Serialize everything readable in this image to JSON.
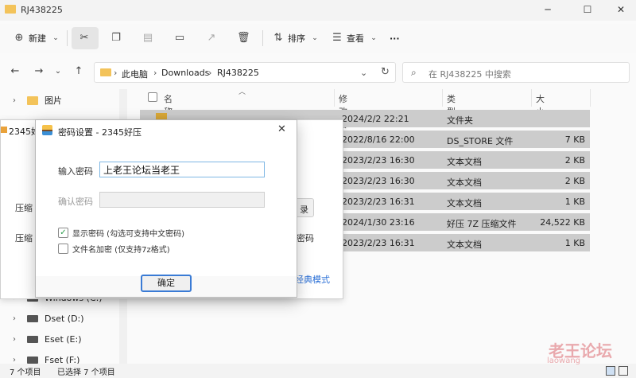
{
  "window": {
    "title": "RJ438225"
  },
  "toolbar": {
    "new_label": "新建",
    "sort_label": "排序",
    "view_label": "查看",
    "more_label": "···"
  },
  "address": {
    "crumbs": [
      "此电脑",
      "Downloads",
      "RJ438225"
    ],
    "search_placeholder": "在 RJ438225 中搜索"
  },
  "sidebar": {
    "items": [
      {
        "label": "图片",
        "icon": "pictures-folder-icon"
      },
      {
        "label": "Windows (C:)",
        "icon": "drive-icon"
      },
      {
        "label": "Dset (D:)",
        "icon": "drive-icon"
      },
      {
        "label": "Eset (E:)",
        "icon": "drive-icon"
      },
      {
        "label": "Fset (F:)",
        "icon": "drive-icon"
      }
    ]
  },
  "columns": {
    "name": "名称",
    "modified": "修改日期",
    "type": "类型",
    "size": "大小"
  },
  "files": [
    {
      "date": "2024/2/2 22:21",
      "type": "文件夹",
      "size": ""
    },
    {
      "date": "2022/8/16 22:00",
      "type": "DS_STORE 文件",
      "size": "7 KB"
    },
    {
      "date": "2023/2/23 16:30",
      "type": "文本文档",
      "size": "2 KB"
    },
    {
      "date": "2023/2/23 16:30",
      "type": "文本文档",
      "size": "2 KB"
    },
    {
      "date": "2023/2/23 16:31",
      "type": "文本文档",
      "size": "1 KB"
    },
    {
      "date": "2024/1/30 23:16",
      "type": "好压 7Z 压缩文件",
      "size": "24,522 KB"
    },
    {
      "date": "2023/2/23 16:31",
      "type": "文本文档",
      "size": "1 KB"
    }
  ],
  "status": {
    "count": "7 个项目",
    "selected": "已选择 7 个项目"
  },
  "bg_dialog": {
    "title": "2345好",
    "label1": "压缩",
    "label2": "压缩",
    "button": "录",
    "text1": "密码",
    "link": "经典模式"
  },
  "pw_dialog": {
    "title": "密码设置 - 2345好压",
    "password_label": "输入密码",
    "password_value": "上老王论坛当老王",
    "confirm_label": "确认密码",
    "confirm_value": "",
    "show_password_label": "显示密码 (勾选可支持中文密码)",
    "encrypt_names_label": "文件名加密 (仅支持7z格式)",
    "ok_label": "确定"
  },
  "watermark": {
    "text": "老王论坛",
    "sub": "laowang"
  }
}
